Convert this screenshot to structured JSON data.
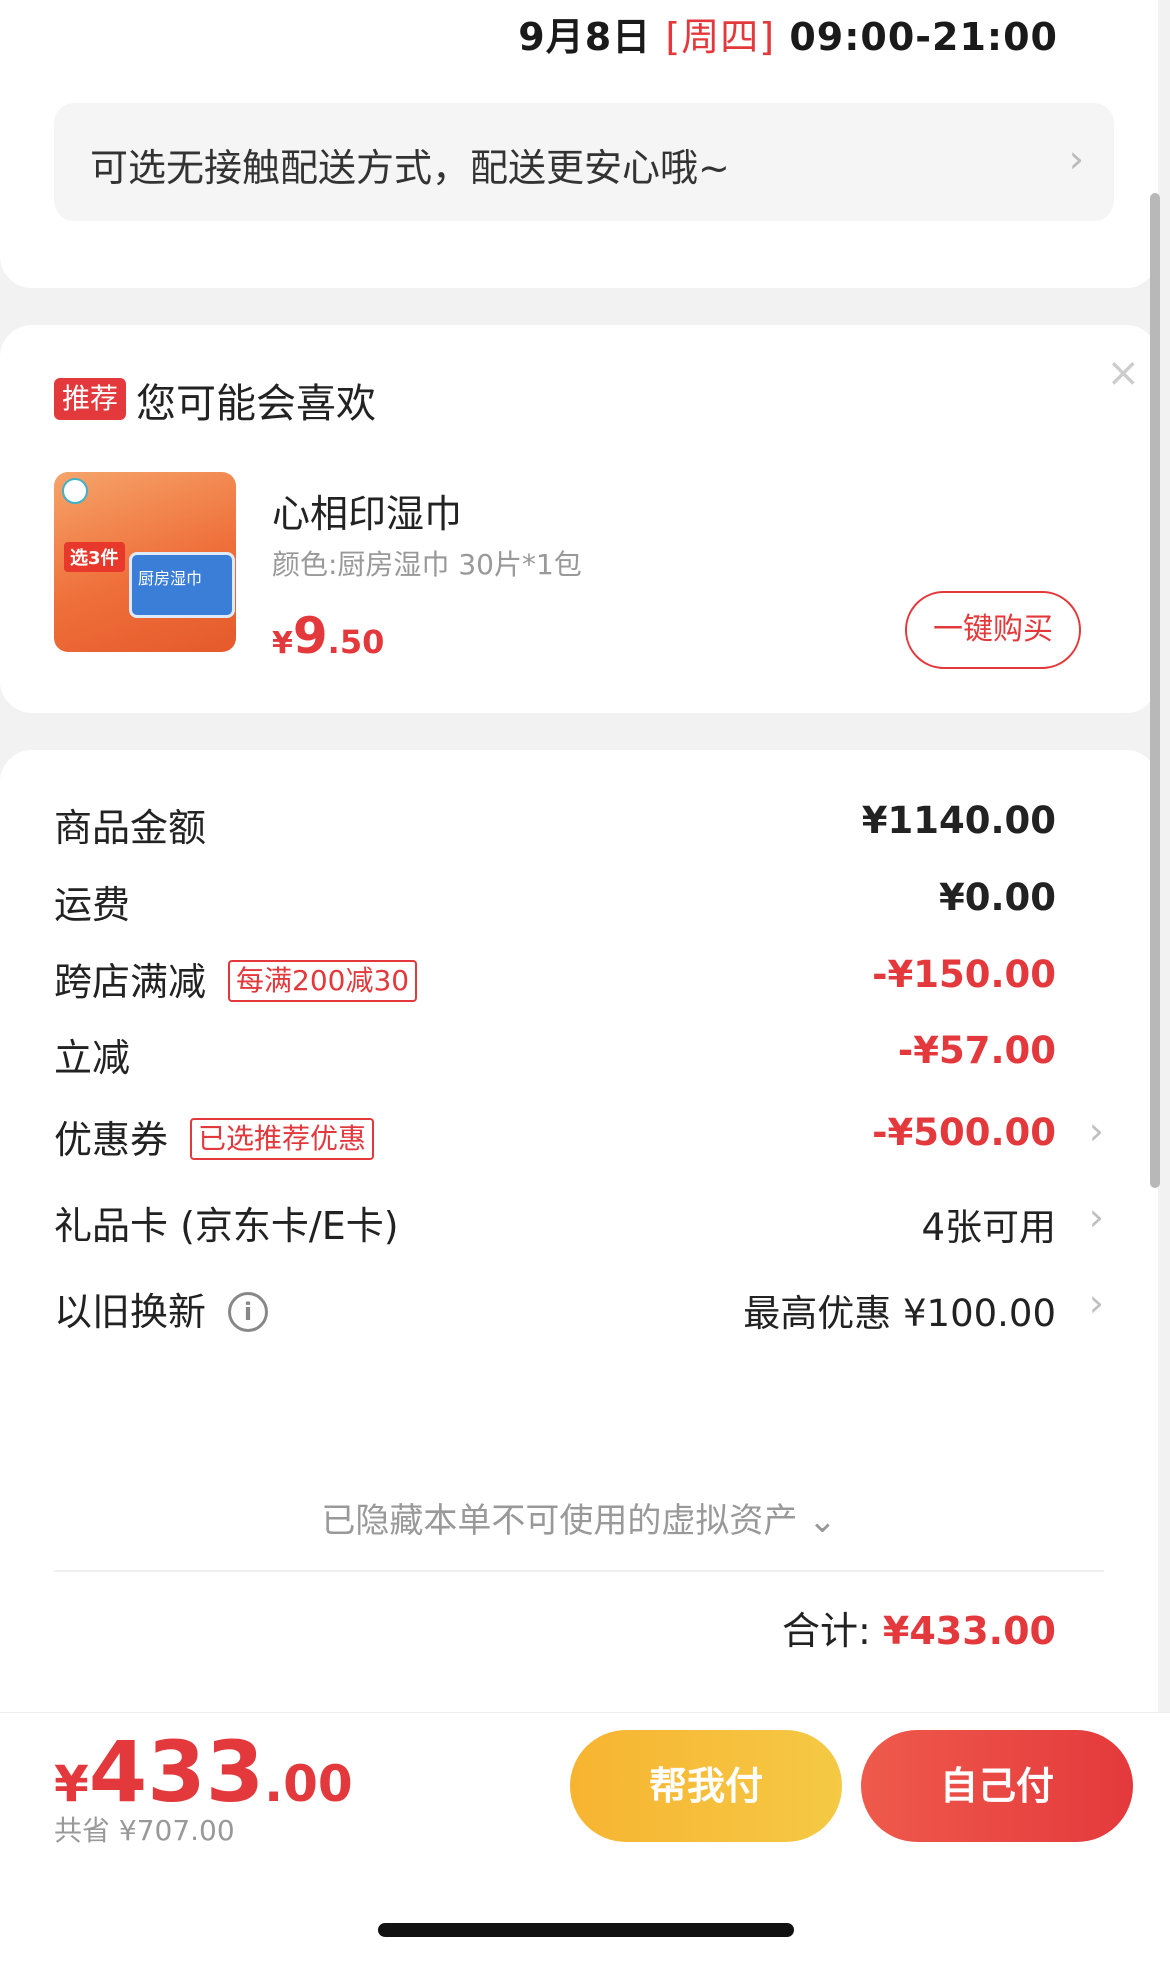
{
  "delivery": {
    "date": "9月8日",
    "weekday": "[周四]",
    "time_range": "09:00-21:00",
    "contactless_text": "可选无接触配送方式，配送更安心哦~",
    "arrow": "›"
  },
  "recommend": {
    "badge": "推荐",
    "title": "您可能会喜欢",
    "close": "×",
    "product": {
      "name": "心相印湿巾",
      "spec": "颜色:厨房湿巾 30片*1包",
      "price_symbol": "¥",
      "price_int": "9",
      "price_dec": ".50",
      "image_tag": "选3件",
      "image_pack_label": "厨房湿巾",
      "buy_label": "一键购买"
    }
  },
  "summary": {
    "rows": [
      {
        "label": "商品金额",
        "value": "¥1140.00"
      },
      {
        "label": "运费",
        "value": "¥0.00"
      },
      {
        "label": "跨店满减",
        "tag": "每满200减30",
        "value": "-¥150.00"
      },
      {
        "label": "立减",
        "value": "-¥57.00"
      },
      {
        "label": "优惠券",
        "tag": "已选推荐优惠",
        "value": "-¥500.00"
      },
      {
        "label": "礼品卡 (京东卡/E卡)",
        "value": "4张可用"
      },
      {
        "label": "以旧换新",
        "info": "i",
        "value": "最高优惠 ¥100.00"
      }
    ],
    "hidden_assets": "已隐藏本单不可使用的虚拟资产 ⌄",
    "total_label": "合计: ",
    "total_value": "¥433.00"
  },
  "bottom": {
    "price_symbol": "¥",
    "price_int": "433",
    "price_dec": ".00",
    "saved": "共省 ¥707.00",
    "help_pay": "帮我付",
    "self_pay": "自己付"
  },
  "colors": {
    "accent_red": "#e4393c",
    "help_pay_yellow": "#f5c945",
    "page_bg": "#f2f2f2"
  }
}
